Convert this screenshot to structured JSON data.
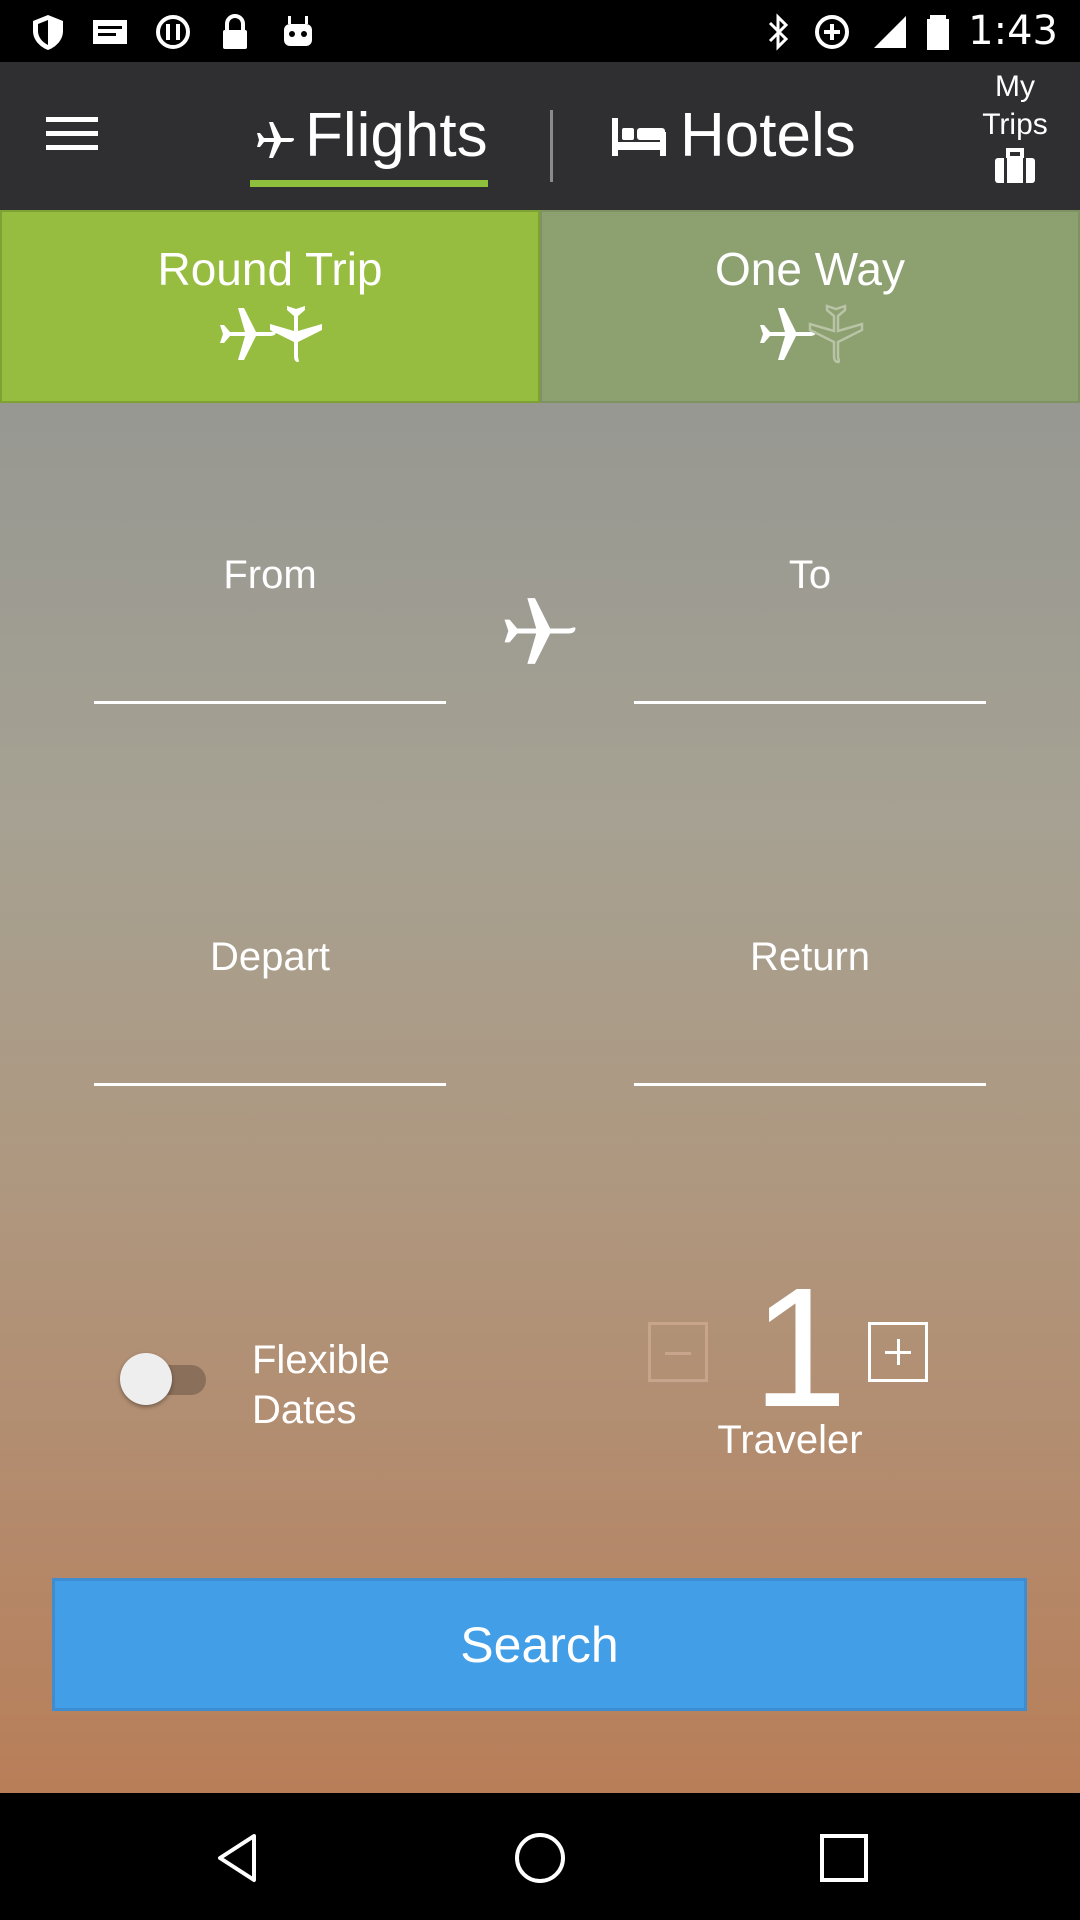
{
  "status_bar": {
    "time": "1:43",
    "left_icons": [
      "shield-icon",
      "mail-icon",
      "sync-icon",
      "lock-icon",
      "android-icon"
    ],
    "right_icons": [
      "bluetooth-icon",
      "data-saver-icon",
      "signal-icon",
      "battery-icon"
    ]
  },
  "nav": {
    "menu_icon": "hamburger-icon",
    "flights_label": "Flights",
    "hotels_label": "Hotels",
    "my_trips_line1": "My",
    "my_trips_line2": "Trips",
    "active_tab": "flights",
    "accent_color": "#8fc03d"
  },
  "trip_type": {
    "round_trip_label": "Round Trip",
    "one_way_label": "One Way",
    "selected": "round_trip"
  },
  "form": {
    "from_label": "From",
    "from_value": "",
    "to_label": "To",
    "to_value": "",
    "depart_label": "Depart",
    "depart_value": "",
    "return_label": "Return",
    "return_value": "",
    "flexible_line1": "Flexible",
    "flexible_line2": "Dates",
    "flexible_enabled": false,
    "traveler_count": "1",
    "traveler_label": "Traveler"
  },
  "search_label": "Search",
  "colors": {
    "search_button": "#419ee7",
    "round_trip_bg": "#96bd3f",
    "one_way_bg": "#8da070",
    "topnav_bg": "#2f2f31"
  }
}
